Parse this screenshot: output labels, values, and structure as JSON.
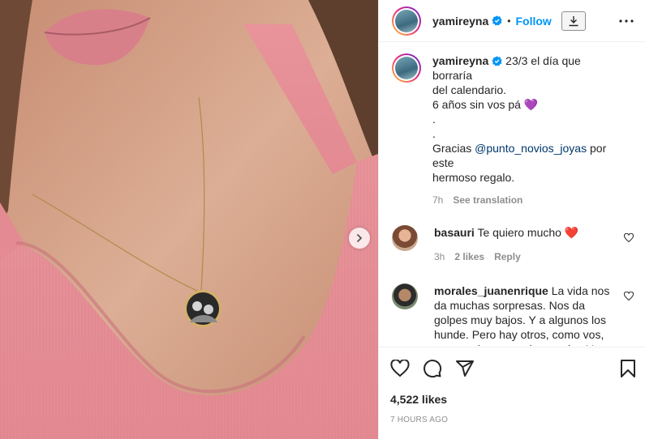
{
  "post": {
    "username": "yamireyna",
    "follow_label": "Follow",
    "dot": "•",
    "caption_user": "yamireyna",
    "caption_lines": [
      "23/3 el día que borraría",
      "del calendario.",
      "6 años sin vos pá 💜",
      ".",
      "."
    ],
    "caption_thanks_before": "Gracias ",
    "caption_mention": "@punto_novios_joyas",
    "caption_thanks_after": " por este",
    "caption_last": "hermoso regalo.",
    "caption_time": "7h",
    "see_translation": "See translation"
  },
  "comments": [
    {
      "username": "basauri",
      "text": "Te quiero mucho ❤️",
      "time": "3h",
      "likes": "2 likes",
      "reply": "Reply"
    },
    {
      "username": "morales_juanenrique",
      "text": "La vida nos da muchas sorpresas. Nos da golpes muy bajos. Y a algunos los hunde. Pero hay otros, como vos, que son los que saben nadar. Y que saben llegar hasta arriba para no ahogarse. Eso fue y es lo que vos hacés."
    }
  ],
  "footer": {
    "likes": "4,522 likes",
    "time_ago": "7 HOURS AGO"
  },
  "colors": {
    "follow": "#0095f6",
    "verified": "#0095f6",
    "heart": "#ed4956",
    "muted": "#8e8e8e"
  }
}
